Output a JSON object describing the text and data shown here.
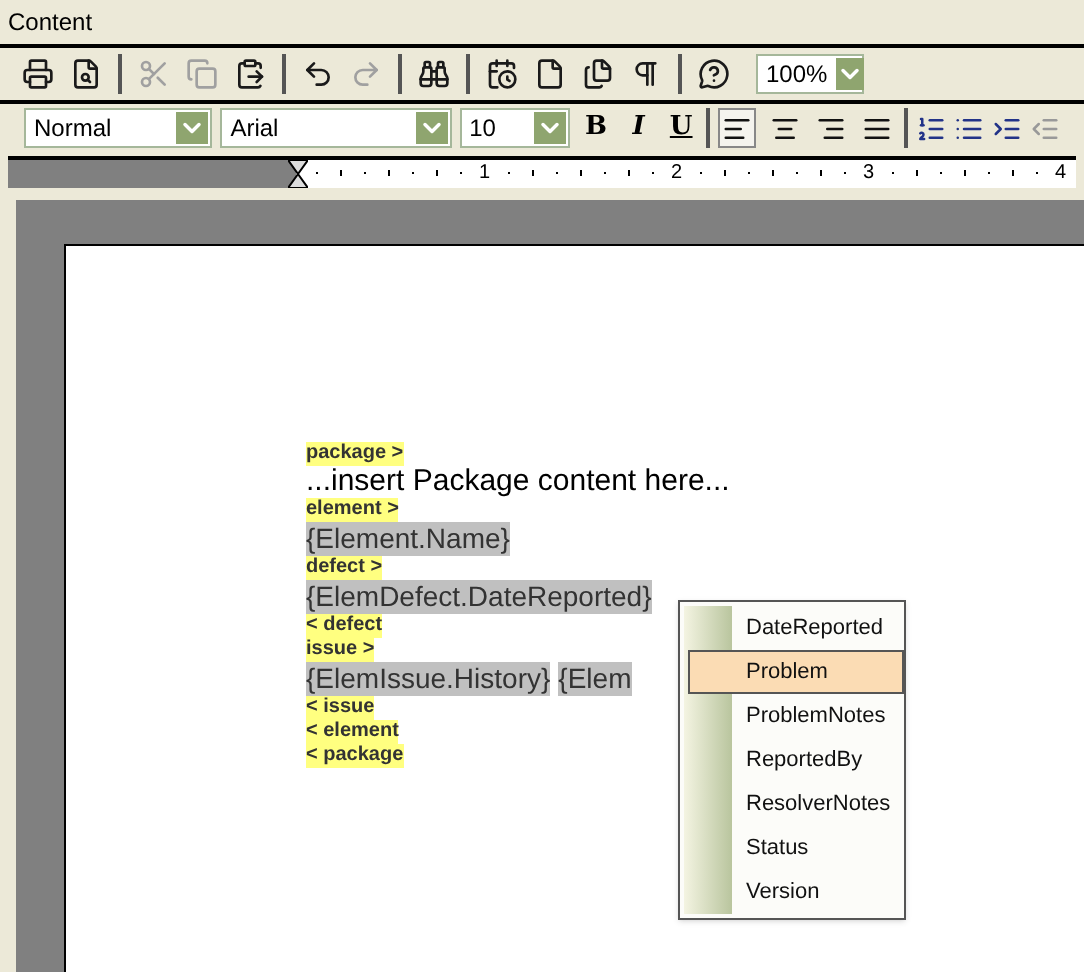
{
  "panel": {
    "title": "Content"
  },
  "toolbar": [
    {
      "kind": "button",
      "disabled": false
    },
    {
      "kind": "button",
      "disabled": false
    },
    {
      "kind": "separator"
    },
    {
      "kind": "button",
      "disabled": true
    },
    {
      "kind": "button",
      "disabled": true
    },
    {
      "kind": "button",
      "disabled": false
    },
    {
      "kind": "separator"
    },
    {
      "kind": "button",
      "disabled": false
    },
    {
      "kind": "button",
      "disabled": true
    },
    {
      "kind": "separator"
    },
    {
      "kind": "button",
      "disabled": false
    },
    {
      "kind": "separator"
    },
    {
      "kind": "button",
      "disabled": false
    },
    {
      "kind": "button",
      "disabled": false
    },
    {
      "kind": "button",
      "disabled": false
    },
    {
      "kind": "button",
      "disabled": false
    },
    {
      "kind": "separator"
    },
    {
      "kind": "button",
      "disabled": false
    },
    {
      "kind": "combo",
      "value": "100%"
    }
  ],
  "format_bar": {
    "style": "Normal",
    "font": "Arial",
    "size": "10",
    "text_buttons": [
      "B",
      "I",
      "U"
    ],
    "align_buttons": [
      {
        "selected": true
      },
      {
        "selected": false
      },
      {
        "selected": false
      },
      {
        "selected": false
      }
    ]
  },
  "ruler": {
    "marks": [
      "1",
      "2",
      "3",
      "4"
    ]
  },
  "document": {
    "lines": [
      {
        "parts": [
          {
            "kind": "tag",
            "text": "package >"
          }
        ]
      },
      {
        "parts": [
          {
            "kind": "text",
            "text": "...insert Package content here..."
          }
        ]
      },
      {
        "parts": [
          {
            "kind": "tag",
            "text": "element >"
          }
        ]
      },
      {
        "parts": [
          {
            "kind": "field",
            "text": "{Element.Name}"
          }
        ]
      },
      {
        "parts": [
          {
            "kind": "tag",
            "text": "defect >"
          }
        ]
      },
      {
        "parts": [
          {
            "kind": "field",
            "text": "{ElemDefect.DateReported}"
          }
        ]
      },
      {
        "parts": [
          {
            "kind": "tag",
            "text": "< defect"
          }
        ]
      },
      {
        "parts": [
          {
            "kind": "tag",
            "text": "issue >"
          }
        ]
      },
      {
        "parts": [
          {
            "kind": "field",
            "text": "{ElemIssue.History}"
          },
          {
            "kind": "field",
            "text": "{Elem"
          }
        ]
      },
      {
        "parts": [
          {
            "kind": "tag",
            "text": "< issue"
          }
        ]
      },
      {
        "parts": [
          {
            "kind": "tag",
            "text": "< element"
          }
        ]
      },
      {
        "parts": [
          {
            "kind": "tag",
            "text": "< package"
          }
        ]
      }
    ]
  },
  "popup_menu": {
    "items": [
      {
        "label": "DateReported",
        "selected": false
      },
      {
        "label": "Problem",
        "selected": true
      },
      {
        "label": "ProblemNotes",
        "selected": false
      },
      {
        "label": "ReportedBy",
        "selected": false
      },
      {
        "label": "ResolverNotes",
        "selected": false
      },
      {
        "label": "Status",
        "selected": false
      },
      {
        "label": "Version",
        "selected": false
      }
    ]
  }
}
